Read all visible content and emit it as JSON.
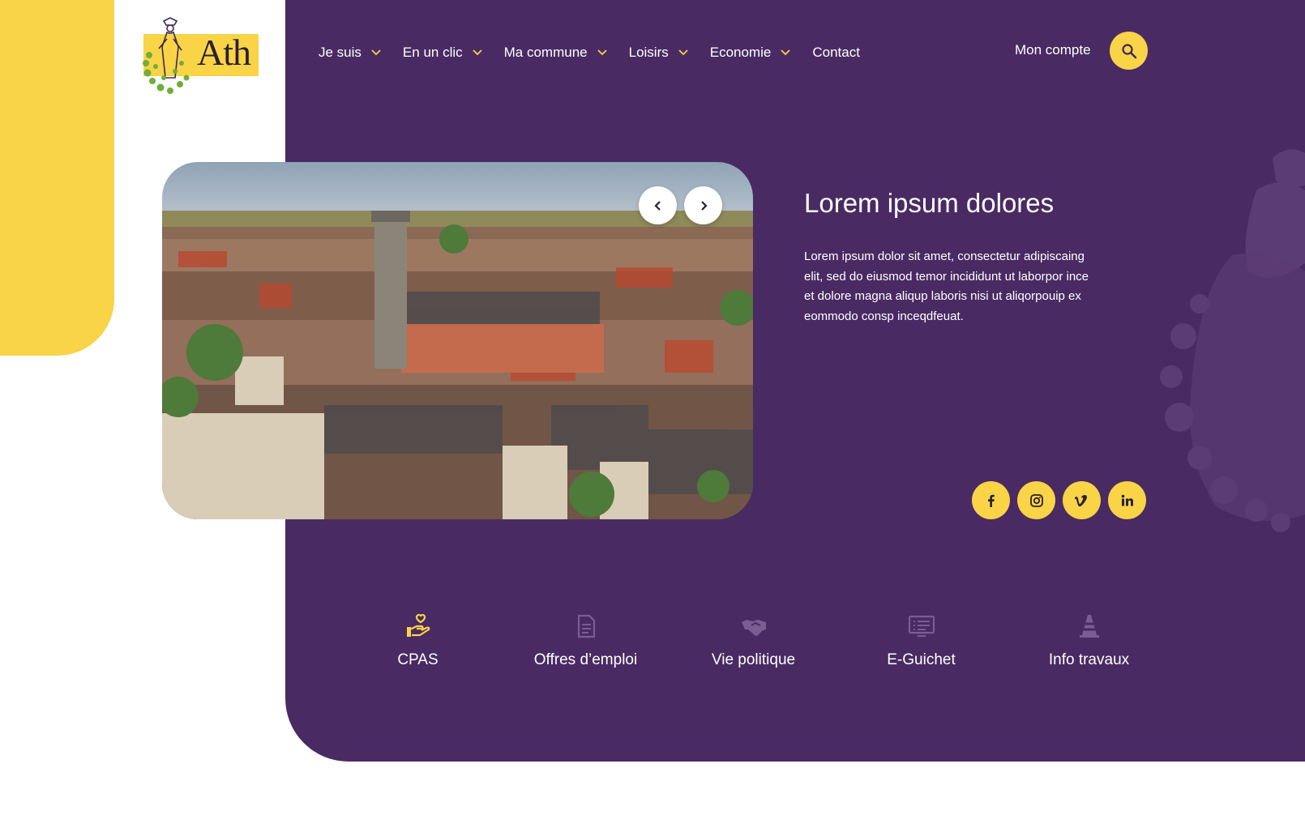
{
  "brand": {
    "logo_text": "Ath",
    "yellow": "#F8D446",
    "purple": "#4A2A63",
    "logo_icon": "giant-figure-with-ivy-icon"
  },
  "nav": {
    "items": [
      {
        "label": "Je suis",
        "has_dropdown": true
      },
      {
        "label": "En un clic",
        "has_dropdown": true
      },
      {
        "label": "Ma commune",
        "has_dropdown": true
      },
      {
        "label": "Loisirs",
        "has_dropdown": true
      },
      {
        "label": "Economie",
        "has_dropdown": true
      },
      {
        "label": "Contact",
        "has_dropdown": false
      }
    ],
    "account_label": "Mon compte",
    "search_icon": "search-icon"
  },
  "hero": {
    "image_subject": "aerial-town-view",
    "prev_icon": "chevron-left-icon",
    "next_icon": "chevron-right-icon",
    "title": "Lorem ipsum dolores",
    "text": "Lorem ipsum dolor sit amet, consectetur adipiscaing elit, sed do eiusmod temor incididunt ut laborpor ince et dolore magna aliqup laboris nisi ut aliqorpouip ex eommodo consp inceqdfeuat."
  },
  "socials": [
    {
      "name": "facebook",
      "icon": "facebook-icon"
    },
    {
      "name": "instagram",
      "icon": "instagram-icon"
    },
    {
      "name": "vimeo",
      "icon": "vimeo-icon"
    },
    {
      "name": "linkedin",
      "icon": "linkedin-icon"
    }
  ],
  "quick_links": [
    {
      "label": "CPAS",
      "icon": "heart-hand-icon",
      "active": true
    },
    {
      "label": "Offres d’emploi",
      "icon": "document-icon",
      "active": false
    },
    {
      "label": "Vie politique",
      "icon": "handshake-icon",
      "active": false
    },
    {
      "label": "E-Guichet",
      "icon": "screen-list-icon",
      "active": false
    },
    {
      "label": "Info travaux",
      "icon": "traffic-cone-icon",
      "active": false
    }
  ]
}
